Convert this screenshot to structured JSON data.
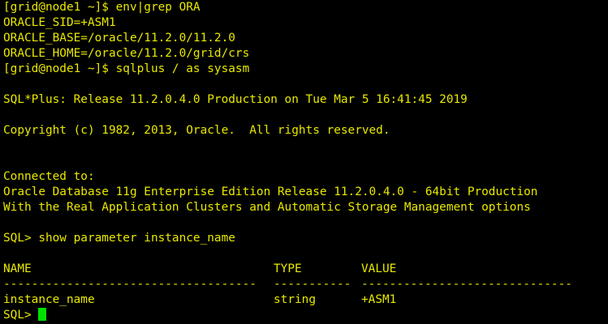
{
  "colors": {
    "background": "#000000",
    "text": "#e8e800",
    "cursor": "#00e000"
  },
  "terminal": {
    "lines": [
      "[grid@node1 ~]$ env|grep ORA",
      "ORACLE_SID=+ASM1",
      "ORACLE_BASE=/oracle/11.2.0/11.2.0",
      "ORACLE_HOME=/oracle/11.2.0/grid/crs",
      "[grid@node1 ~]$ sqlplus / as sysasm",
      "",
      "SQL*Plus: Release 11.2.0.4.0 Production on Tue Mar 5 16:41:45 2019",
      "",
      "Copyright (c) 1982, 2013, Oracle.  All rights reserved.",
      "",
      "",
      "Connected to:",
      "Oracle Database 11g Enterprise Edition Release 11.2.0.4.0 - 64bit Production",
      "With the Real Application Clusters and Automatic Storage Management options",
      "",
      "SQL> show parameter instance_name",
      ""
    ],
    "table": {
      "headers": [
        "NAME",
        "TYPE",
        "VALUE"
      ],
      "separators": [
        "------------------------------------",
        "-----------",
        "------------------------------"
      ],
      "row": [
        "instance_name",
        "string",
        "+ASM1"
      ]
    },
    "prompt": "SQL> "
  }
}
